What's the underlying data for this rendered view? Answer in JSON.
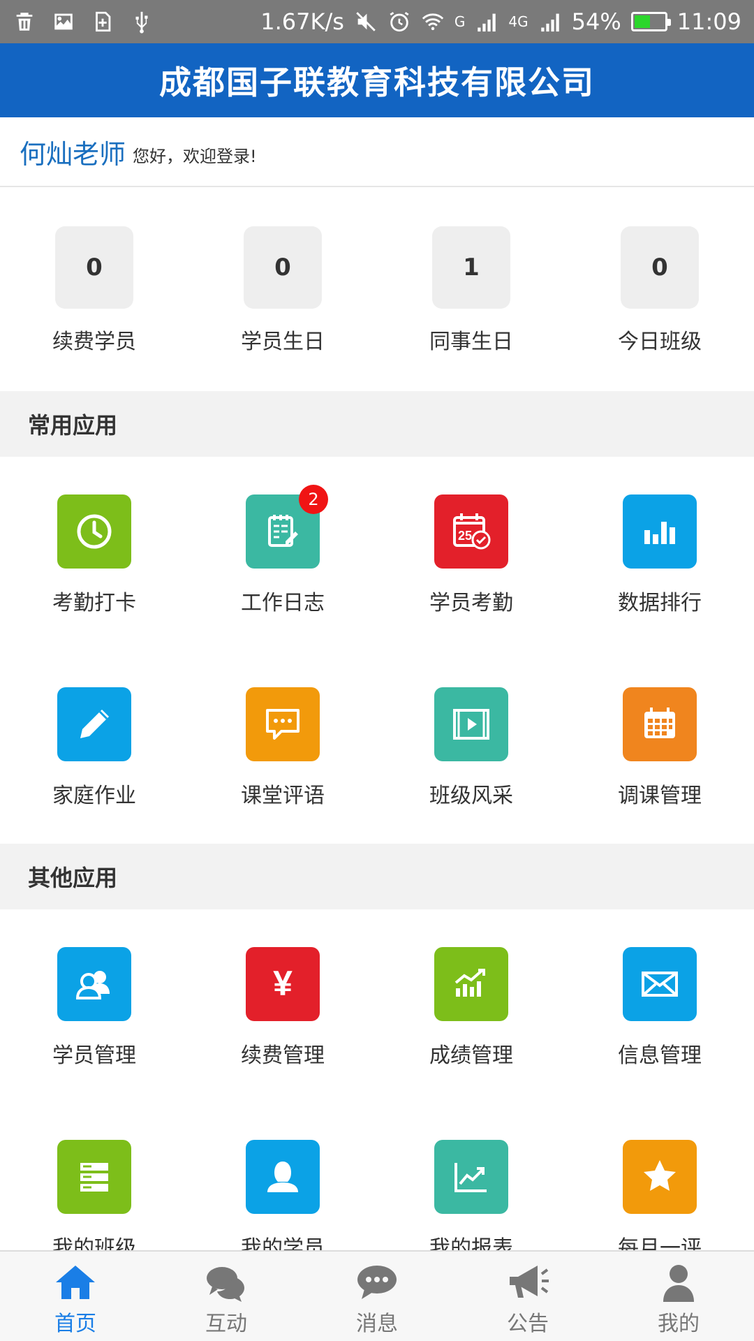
{
  "status_bar": {
    "network_speed": "1.67K/s",
    "sig1": "G",
    "sig2": "4G",
    "battery": "54%",
    "battery_level": 0.54,
    "time": "11:09"
  },
  "header": {
    "title": "成都国子联教育科技有限公司"
  },
  "welcome": {
    "teacher": "何灿老师",
    "greeting": "您好，欢迎登录!"
  },
  "stats": [
    {
      "value": "0",
      "label": "续费学员"
    },
    {
      "value": "0",
      "label": "学员生日"
    },
    {
      "value": "1",
      "label": "同事生日"
    },
    {
      "value": "0",
      "label": "今日班级"
    }
  ],
  "sections": {
    "common": "常用应用",
    "other": "其他应用"
  },
  "common_apps": [
    {
      "label": "考勤打卡",
      "icon": "clock-icon",
      "color": "#7dbe1a"
    },
    {
      "label": "工作日志",
      "icon": "notepad-icon",
      "color": "#3bb8a2",
      "badge": "2"
    },
    {
      "label": "学员考勤",
      "icon": "calendar-check-icon",
      "color": "#e3202a",
      "day": "25"
    },
    {
      "label": "数据排行",
      "icon": "bar-chart-icon",
      "color": "#0ba2e6"
    },
    {
      "label": "家庭作业",
      "icon": "pencil-icon",
      "color": "#0ba2e6"
    },
    {
      "label": "课堂评语",
      "icon": "chat-bubble-icon",
      "color": "#f29a0b"
    },
    {
      "label": "班级风采",
      "icon": "video-icon",
      "color": "#3bb8a2"
    },
    {
      "label": "调课管理",
      "icon": "calendar-grid-icon",
      "color": "#f0851e"
    }
  ],
  "other_apps": [
    {
      "label": "学员管理",
      "icon": "users-icon",
      "color": "#0ba2e6"
    },
    {
      "label": "续费管理",
      "icon": "yen-icon",
      "color": "#e3202a",
      "glyph": "¥"
    },
    {
      "label": "成绩管理",
      "icon": "trend-chart-icon",
      "color": "#7dbe1a"
    },
    {
      "label": "信息管理",
      "icon": "envelope-icon",
      "color": "#0ba2e6"
    },
    {
      "label": "我的班级",
      "icon": "server-stack-icon",
      "color": "#7dbe1a"
    },
    {
      "label": "我的学员",
      "icon": "person-icon",
      "color": "#0ba2e6"
    },
    {
      "label": "我的报表",
      "icon": "line-chart-icon",
      "color": "#3bb8a2"
    },
    {
      "label": "每月一评",
      "icon": "star-icon",
      "color": "#f29a0b"
    }
  ],
  "bottom_nav": [
    {
      "label": "首页",
      "icon": "home-icon",
      "active": true
    },
    {
      "label": "互动",
      "icon": "chat-icon"
    },
    {
      "label": "消息",
      "icon": "message-icon"
    },
    {
      "label": "公告",
      "icon": "megaphone-icon"
    },
    {
      "label": "我的",
      "icon": "profile-icon"
    }
  ],
  "colors": {
    "header": "#1264c2",
    "active_nav": "#1a7ee6",
    "inactive_nav": "#777777"
  }
}
